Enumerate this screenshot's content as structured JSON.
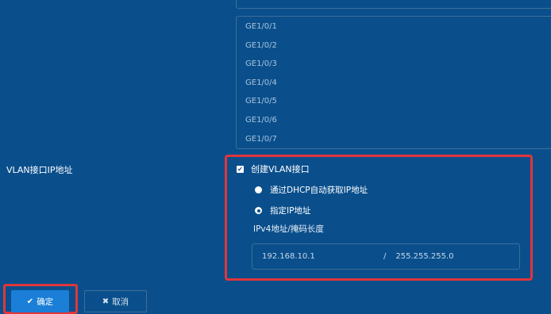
{
  "ports": [
    "GE1/0/1",
    "GE1/0/2",
    "GE1/0/3",
    "GE1/0/4",
    "GE1/0/5",
    "GE1/0/6",
    "GE1/0/7"
  ],
  "vlan_ip": {
    "label": "VLAN接口IP地址",
    "create_checkbox": {
      "label": "创建VLAN接口",
      "checked": true
    },
    "options": [
      {
        "label": "通过DHCP自动获取IP地址",
        "selected": false
      },
      {
        "label": "指定IP地址",
        "selected": true
      }
    ],
    "ip_mask_label": "IPv4地址/掩码长度",
    "ip_value": "192.168.10.1",
    "separator": "/",
    "mask_value": "255.255.255.0"
  },
  "buttons": {
    "ok_icon": "✔",
    "ok_label": "确定",
    "cancel_icon": "✖",
    "cancel_label": "取消"
  },
  "colors": {
    "background": "#0a4f8c",
    "highlight": "#e0363a",
    "primary_button": "#1b7fd8"
  }
}
